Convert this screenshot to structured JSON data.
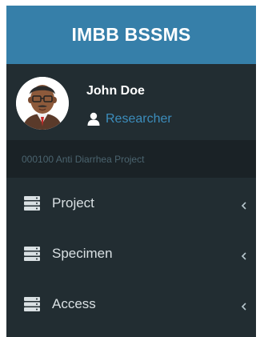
{
  "app": {
    "title": "IMBB BSSMS"
  },
  "user": {
    "name": "John Doe",
    "role": "Researcher"
  },
  "project": {
    "label": "000100 Anti Diarrhea Project"
  },
  "menu": {
    "items": [
      {
        "label": "Project",
        "icon": "server-icon"
      },
      {
        "label": "Specimen",
        "icon": "server-icon"
      },
      {
        "label": "Access",
        "icon": "server-icon"
      }
    ]
  },
  "colors": {
    "header": "#367fa9",
    "sidebar": "#222d32",
    "project_bar": "#1a2226",
    "accent": "#3c8dbc"
  }
}
